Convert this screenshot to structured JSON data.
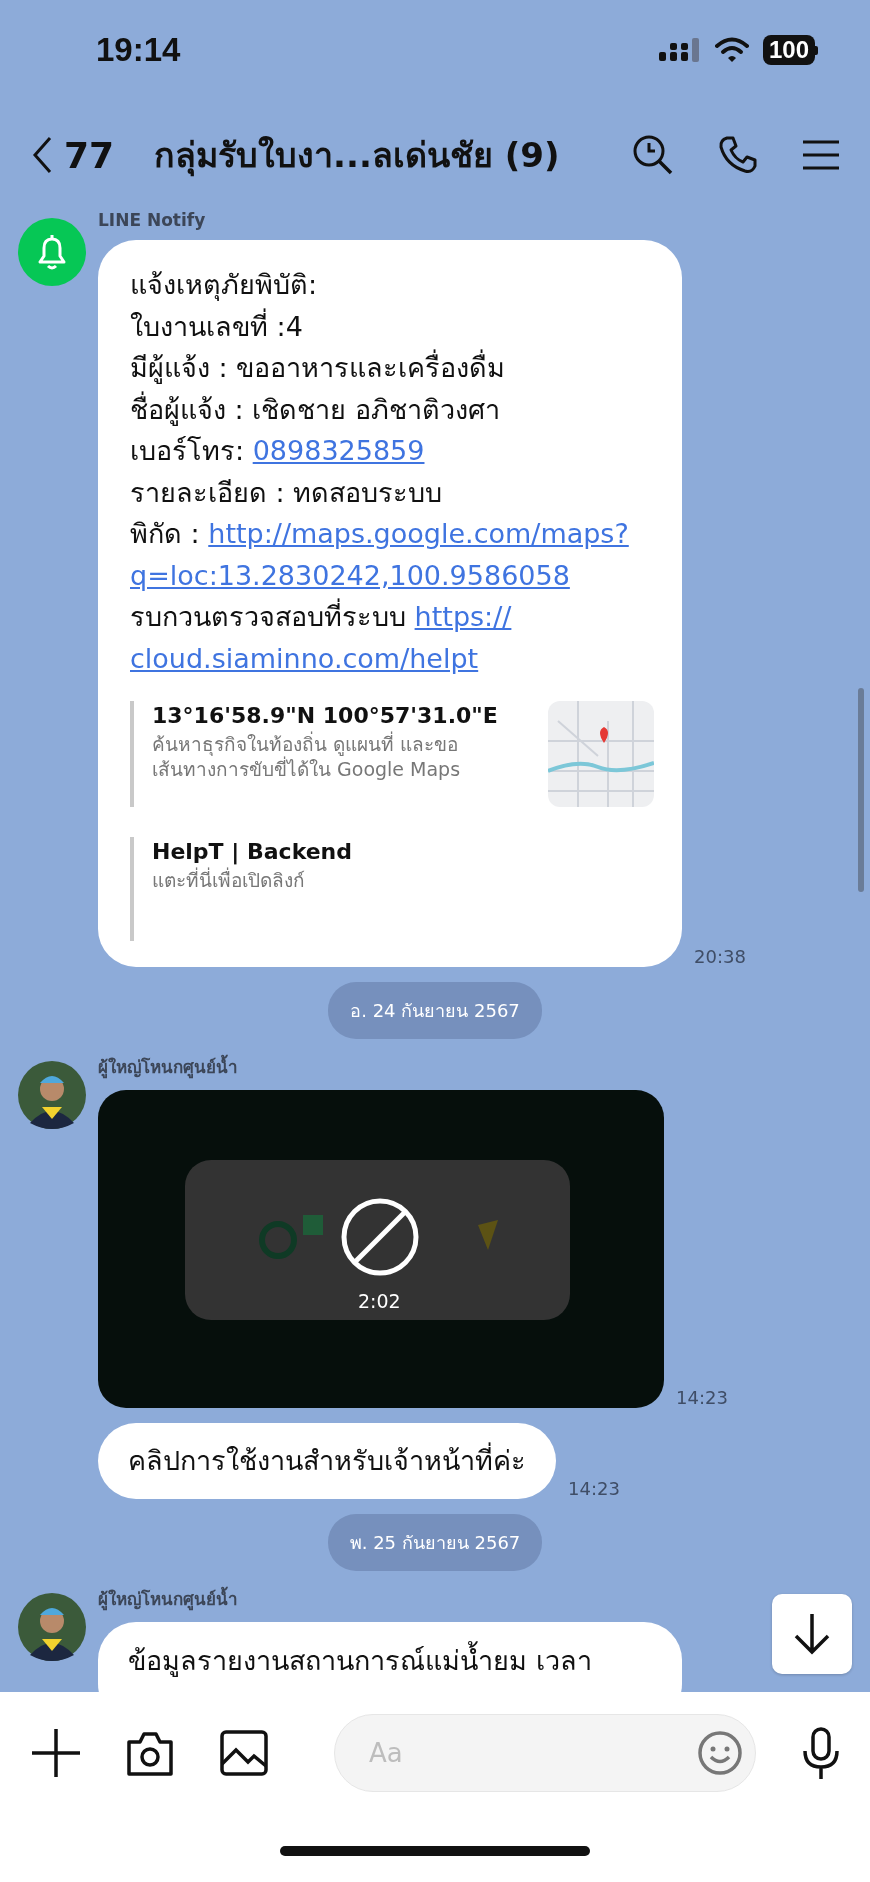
{
  "status_bar": {
    "time": "19:14",
    "battery": "100"
  },
  "header": {
    "back_count": "77",
    "title": "กลุ่มรับใบงา...ลเด่นชัย (9)"
  },
  "messages": [
    {
      "kind": "notify",
      "sender": "LINE Notify",
      "lines": [
        [
          {
            "text": "แจ้งเหตุภัยพิบัติ:",
            "link": false
          }
        ],
        [
          {
            "text": "ใบงานเลขที่ :4",
            "link": false
          }
        ],
        [
          {
            "text": "มีผู้แจ้ง : ขออาหารและเครื่องดื่ม",
            "link": false
          }
        ],
        [
          {
            "text": "ชื่อผู้แจ้ง : เชิดชาย  อภิชาติวงศา",
            "link": false
          }
        ],
        [
          {
            "text": "เบอร์โทร: ",
            "link": false
          },
          {
            "text": "0898325859",
            "link": true
          }
        ],
        [
          {
            "text": "รายละเอียด : ทดสอบระบบ",
            "link": false
          }
        ],
        [
          {
            "text": "พิกัด : ",
            "link": false
          },
          {
            "text": "http://maps.google.com/maps?",
            "link": true
          }
        ],
        [
          {
            "text": "q=loc:13.2830242,100.9586058",
            "link": true
          }
        ],
        [
          {
            "text": "รบกวนตรวจสอบที่ระบบ   ",
            "link": false
          },
          {
            "text": "https://",
            "link": true
          }
        ],
        [
          {
            "text": "cloud.siaminno.com/helpt",
            "link": true
          }
        ]
      ],
      "previews": [
        {
          "title": "13°16'58.9\"N 100°57'31.0\"E",
          "description": "ค้นหาธุรกิจในท้องถิ่น ดูแผนที่ และขอ\nเส้นทางการขับขี่ได้ใน Google Maps",
          "kind": "picture"
        },
        {
          "title": "HelpT | Backend",
          "description": "แตะที่นี่เพื่อเปิดลิงก์"
        }
      ],
      "time": "20:38"
    },
    {
      "kind": "date",
      "label": "อ. 24 กันยายน 2567"
    },
    {
      "kind": "video",
      "sender": "ผู้ใหญ่โหนกศูนย์น้ำ",
      "duration": "2:02",
      "time": "14:23"
    },
    {
      "kind": "text",
      "text": "คลิปการใช้งานสำหรับเจ้าหน้าที่ค่ะ",
      "time": "14:23"
    },
    {
      "kind": "date",
      "label": "พ. 25 กันยายน 2567"
    },
    {
      "kind": "text",
      "sender": "ผู้ใหญ่โหนกศูนย์น้ำ",
      "text": "ข้อมูลรายงานสถานการณ์แม่น้ำยม เวลา"
    }
  ],
  "composer": {
    "placeholder": "Aa"
  }
}
